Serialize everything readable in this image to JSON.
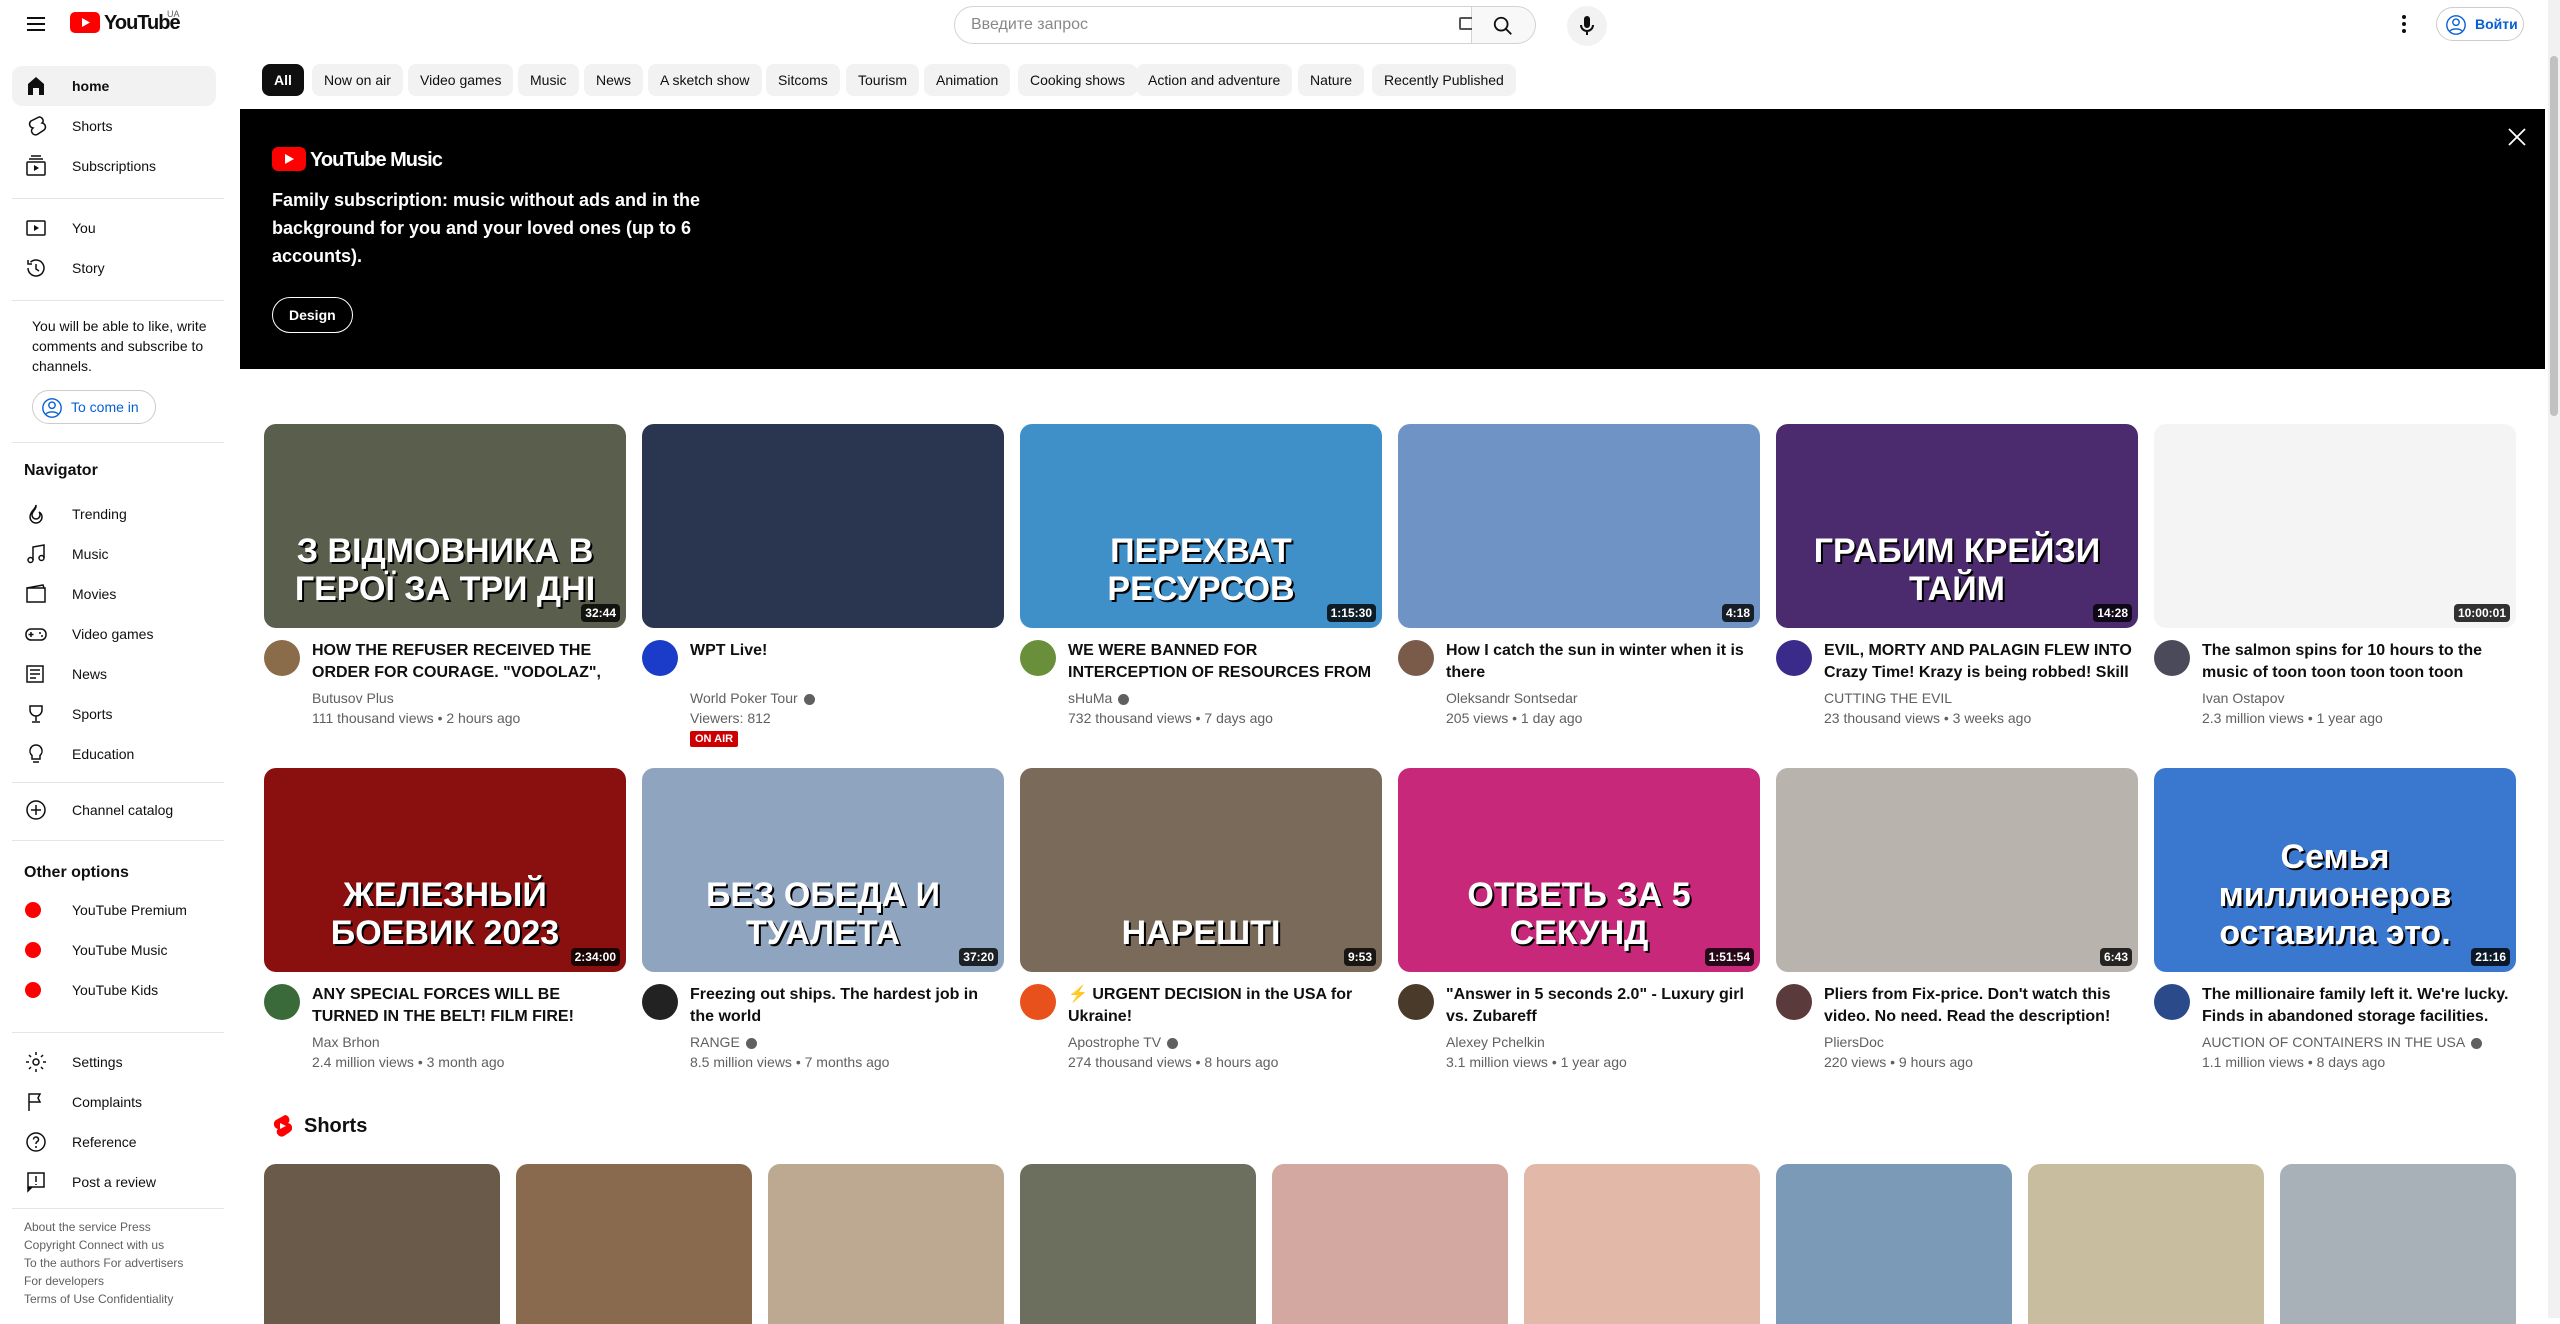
{
  "header": {
    "logo_text": "YouTube",
    "region": "UA",
    "search_placeholder": "Введите запрос",
    "sign_in": "Войти"
  },
  "sidebar": {
    "main": [
      {
        "label": "home",
        "icon": "home-icon"
      },
      {
        "label": "Shorts",
        "icon": "shorts-icon"
      },
      {
        "label": "Subscriptions",
        "icon": "subscriptions-icon"
      }
    ],
    "you": [
      {
        "label": "You",
        "icon": "you-icon"
      },
      {
        "label": "Story",
        "icon": "history-icon"
      }
    ],
    "signin_note": "You will be able to like, write comments and subscribe to channels.",
    "signin_button": "To come in",
    "navigator_title": "Navigator",
    "navigator": [
      {
        "label": "Trending",
        "icon": "trending-icon"
      },
      {
        "label": "Music",
        "icon": "music-icon"
      },
      {
        "label": "Movies",
        "icon": "movies-icon"
      },
      {
        "label": "Video games",
        "icon": "gaming-icon"
      },
      {
        "label": "News",
        "icon": "news-icon"
      },
      {
        "label": "Sports",
        "icon": "sports-icon"
      },
      {
        "label": "Education",
        "icon": "education-icon"
      }
    ],
    "catalog": "Channel catalog",
    "other_title": "Other options",
    "other": [
      {
        "label": "YouTube Premium",
        "icon": "youtube-premium-icon"
      },
      {
        "label": "YouTube Music",
        "icon": "youtube-music-icon"
      },
      {
        "label": "YouTube Kids",
        "icon": "youtube-kids-icon"
      }
    ],
    "settings": [
      {
        "label": "Settings",
        "icon": "settings-icon"
      },
      {
        "label": "Complaints",
        "icon": "flag-icon"
      },
      {
        "label": "Reference",
        "icon": "help-icon"
      },
      {
        "label": "Post a review",
        "icon": "feedback-icon"
      }
    ],
    "footer": [
      "About the service  Press",
      "Copyright  Connect with us",
      "To the authors  For advertisers",
      "For developers",
      "Terms of Use  Confidentiality"
    ]
  },
  "chips": [
    "All",
    "Now on air",
    "Video games",
    "Music",
    "News",
    "A sketch show",
    "Sitcoms",
    "Tourism",
    "Animation",
    "Cooking shows",
    "Action and adventure",
    "Nature",
    "Recently Published"
  ],
  "banner": {
    "logo": "YouTube Music",
    "text": "Family subscription: music without ads and in the background for you and your loved ones (up to 6 accounts).",
    "button": "Design"
  },
  "videos": [
    {
      "title": "HOW THE REFUSER RECEIVED THE ORDER FOR COURAGE. \"VODOLAZ\", \"YOUR GRAVE IS THERE\"",
      "channel": "Butusov Plus",
      "meta": "111 thousand views • 2 hours ago",
      "duration": "32:44",
      "thumb_text": "З ВІДМОВНИКА В ГЕРОЇ ЗА ТРИ ДНІ",
      "thumb_color": "#5a5e4c",
      "avatar_color": "#8a6b4a"
    },
    {
      "title": "WPT Live!",
      "channel": "World Poker Tour",
      "meta": "Viewers: 812",
      "duration": "",
      "live": "ON AIR",
      "thumb_text": "",
      "thumb_color": "#2a3550",
      "avatar_color": "#1a3cc8"
    },
    {
      "title": "WE WERE BANNED FOR INTERCEPTION OF RESOURCES FROM THE CLAN IN RUST",
      "channel": "sHuMa",
      "meta": "732 thousand views • 7 days ago",
      "duration": "1:15:30",
      "thumb_text": "ПЕРЕХВАТ РЕСУРСОВ",
      "thumb_color": "#3f8fc9",
      "avatar_color": "#6a8f3a"
    },
    {
      "title": "How I catch the sun in winter when it is there",
      "channel": "Oleksandr Sontsedar",
      "meta": "205 views • 1 day ago",
      "duration": "4:18",
      "thumb_text": "",
      "thumb_color": "#6f93c4",
      "avatar_color": "#7a5a48"
    },
    {
      "title": "EVIL, MORTY AND PALAGIN FLEW INTO Crazy Time! Krazy is being robbed! Skill Issue",
      "channel": "CUTTING THE EVIL",
      "meta": "23 thousand views • 3 weeks ago",
      "duration": "14:28",
      "thumb_text": "ГРАБИМ КРЕЙЗИ ТАЙМ",
      "thumb_color": "#4c2a6e",
      "avatar_color": "#3a2a8a"
    },
    {
      "title": "The salmon spins for 10 hours to the music of toon toon toon toon toon",
      "channel": "Ivan Ostapov",
      "meta": "2.3 million views • 1 year ago",
      "duration": "10:00:01",
      "thumb_text": "",
      "thumb_color": "#f4f4f4",
      "avatar_color": "#4a4a5a"
    },
    {
      "title": "ANY SPECIAL FORCES WILL BE TURNED IN THE BELT! FILM FIRE! \"IRON\" Russian action movie",
      "channel": "Max Brhon",
      "meta": "2.4 million views • 3 month ago",
      "duration": "2:34:00",
      "thumb_text": "ЖЕЛЕЗНЫЙ БОЕВИК 2023",
      "thumb_color": "#8a1010",
      "avatar_color": "#3a6a3a"
    },
    {
      "title": "Freezing out ships. The hardest job in the world",
      "channel": "RANGE",
      "meta": "8.5 million views • 7 months ago",
      "duration": "37:20",
      "thumb_text": "БЕЗ ОБЕДА И ТУАЛЕТА",
      "thumb_color": "#8ea4bf",
      "avatar_color": "#222222"
    },
    {
      "title": "⚡ URGENT DECISION in the USA for Ukraine!",
      "channel": "Apostrophe TV",
      "meta": "274 thousand views • 8 hours ago",
      "duration": "9:53",
      "thumb_text": "НАРЕШТІ",
      "thumb_color": "#7a6a5a",
      "avatar_color": "#e8501c"
    },
    {
      "title": "\"Answer in 5 seconds 2.0\" - Luxury girl vs. Zubareff",
      "channel": "Alexey Pchelkin",
      "meta": "3.1 million views • 1 year ago",
      "duration": "1:51:54",
      "thumb_text": "ОТВЕТЬ ЗА 5 СЕКУНД",
      "thumb_color": "#c7287a",
      "avatar_color": "#4a3a2a"
    },
    {
      "title": "Pliers from Fix-price. Don't watch this video. No need. Read the description!",
      "channel": "PliersDoc",
      "meta": "220 views • 9 hours ago",
      "duration": "6:43",
      "thumb_text": "",
      "thumb_color": "#b9b3ae",
      "avatar_color": "#5a3a3a"
    },
    {
      "title": "The millionaire family left it. We're lucky. Finds in abandoned storage facilities.",
      "channel": "AUCTION OF CONTAINERS IN THE USA",
      "meta": "1.1 million views • 8 days ago",
      "duration": "21:16",
      "thumb_text": "Семья миллионеров оставила это.",
      "thumb_color": "#3a78d0",
      "avatar_color": "#2a4a8a"
    }
  ],
  "shorts_title": "Shorts",
  "shorts": [
    {
      "color": "#6a5a4a"
    },
    {
      "color": "#8a6a4e"
    },
    {
      "color": "#bda991"
    },
    {
      "color": "#6c6e5e"
    },
    {
      "color": "#d2a8a0"
    },
    {
      "color": "#e2b9a8"
    },
    {
      "color": "#7a9ab8"
    },
    {
      "color": "#c9bda0"
    },
    {
      "color": "#a8b0b8"
    }
  ],
  "colors": {
    "accent": "#065fd4",
    "brand_red": "#ff0000",
    "live_red": "#cc0000"
  }
}
